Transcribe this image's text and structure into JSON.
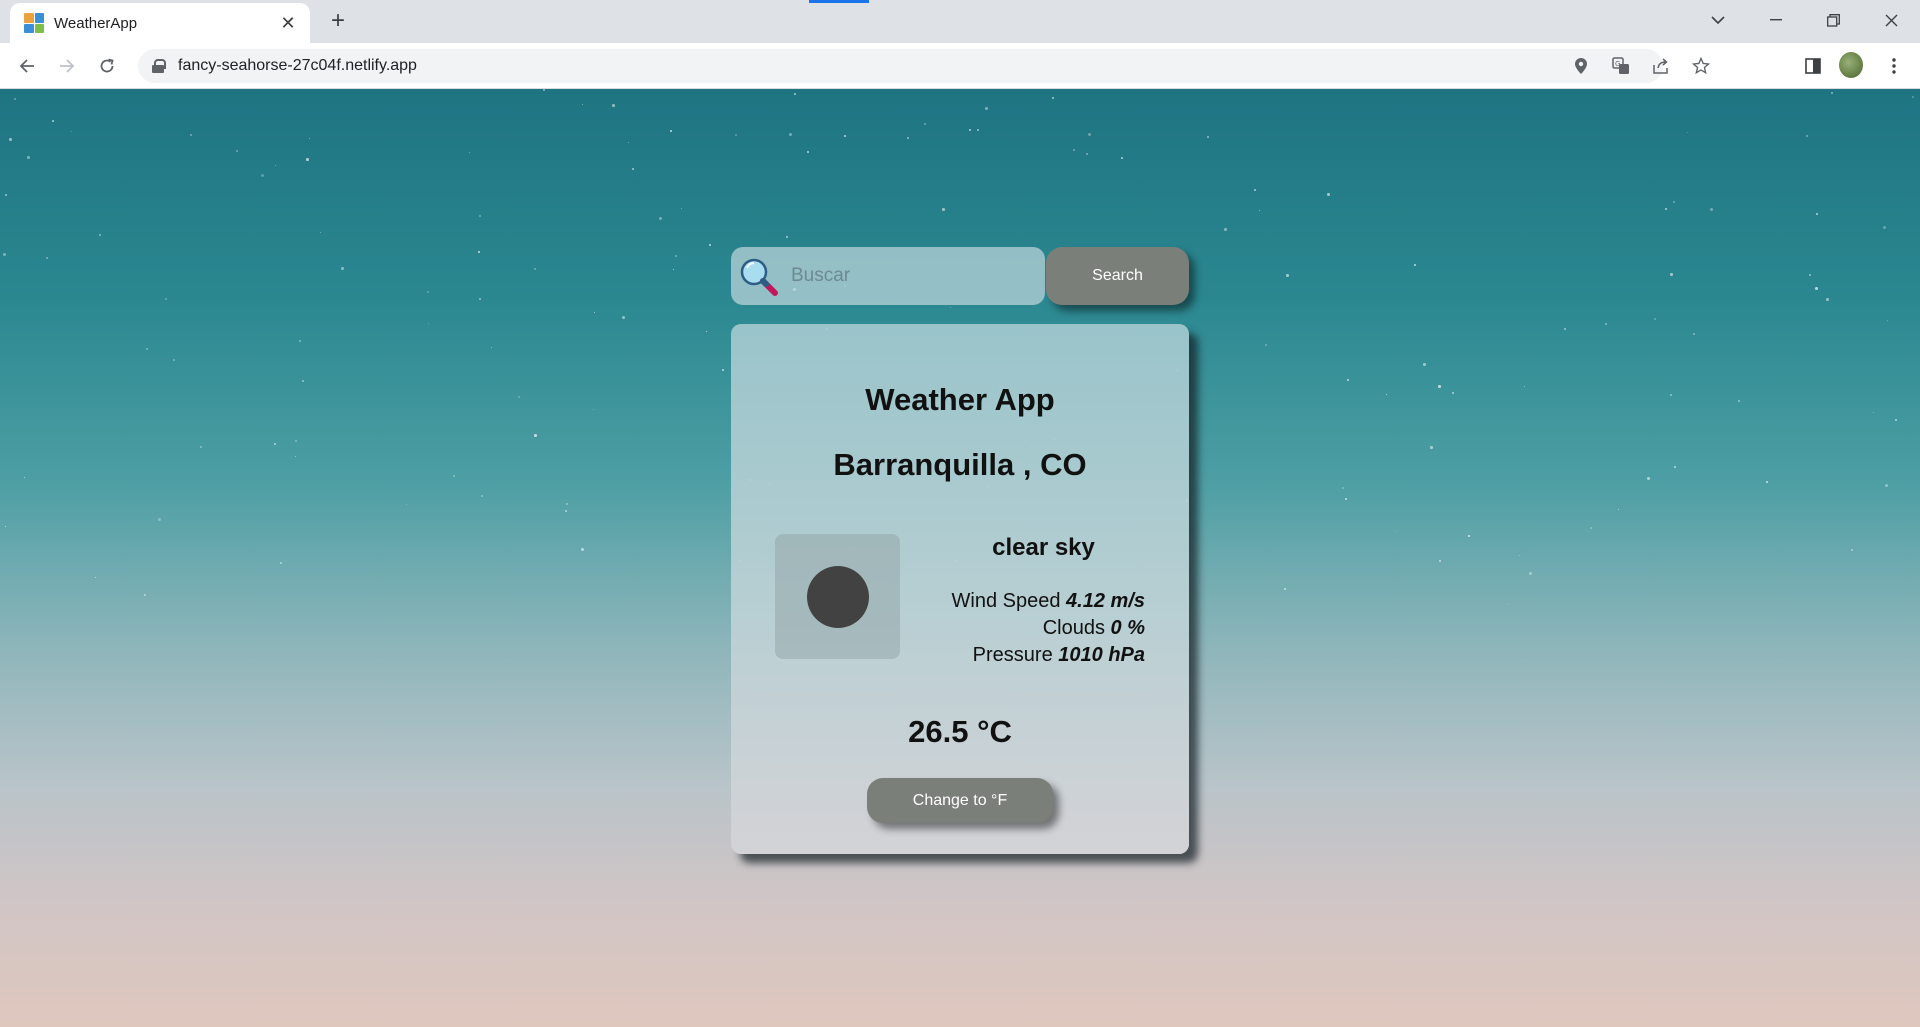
{
  "browser": {
    "tab_title": "WeatherApp",
    "url": "fancy-seahorse-27c04f.netlify.app"
  },
  "search": {
    "placeholder": "Buscar",
    "value": "",
    "button_label": "Search"
  },
  "card": {
    "title": "Weather App",
    "city": "Barranquilla , CO",
    "description": "clear sky",
    "wind_label": "Wind Speed",
    "wind_value": "4.12 m/s",
    "clouds_label": "Clouds",
    "clouds_value": "0 %",
    "pressure_label": "Pressure",
    "pressure_value": "1010 hPa",
    "temperature": "26.5 °C",
    "toggle_label": "Change to °F"
  },
  "colors": {
    "button": "#7b7f79",
    "tab_indicator": "#1a73e8"
  }
}
